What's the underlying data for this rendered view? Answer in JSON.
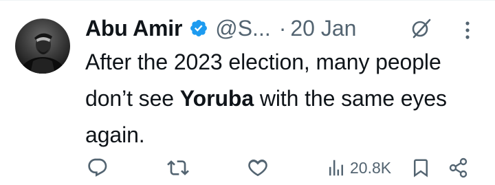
{
  "tweet": {
    "author_name": "Abu Amir",
    "handle": "@S...",
    "separator": "·",
    "date": "20 Jan",
    "text_before": "After the 2023 election, many people don’t see ",
    "text_bold": "Yoruba",
    "text_after": " with the same eyes again."
  },
  "actions": {
    "views": "20.8K"
  },
  "colors": {
    "verified": "#1d9bf0",
    "secondary_text": "#536471",
    "primary_text": "#0f1419"
  },
  "icons": [
    "verified-badge-icon",
    "grok-icon",
    "more-icon",
    "reply-icon",
    "retweet-icon",
    "like-icon",
    "views-icon",
    "bookmark-icon",
    "share-icon"
  ]
}
